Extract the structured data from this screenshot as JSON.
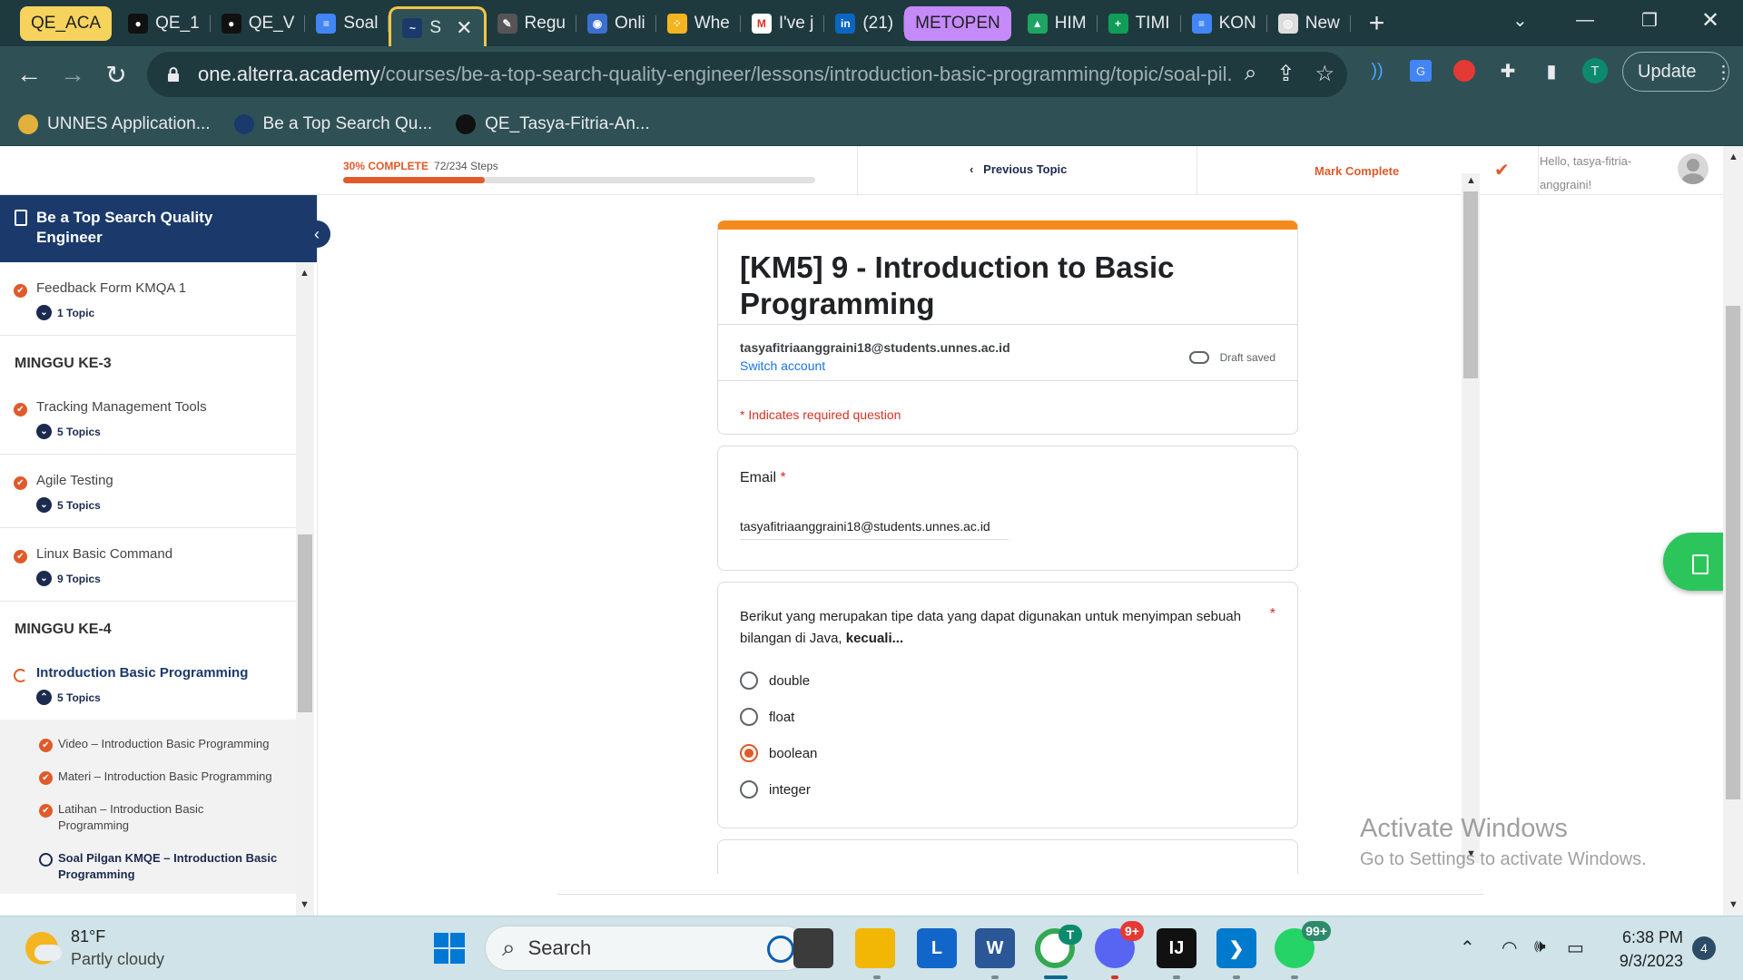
{
  "browser": {
    "tabs": [
      {
        "label": "QE_ACA",
        "kind": "group",
        "color": "#f6d35c",
        "text_color": "#202124"
      },
      {
        "label": "QE_1",
        "icon": "github-icon"
      },
      {
        "label": "QE_V",
        "icon": "github-icon"
      },
      {
        "label": "Soal",
        "icon": "docs-icon"
      },
      {
        "label": "S",
        "icon": "alterra-icon",
        "active": true
      },
      {
        "label": "Regu",
        "icon": "pen-icon"
      },
      {
        "label": "Onli",
        "icon": "circle-icon"
      },
      {
        "label": "Whe",
        "icon": "dots-icon"
      },
      {
        "label": "I've j",
        "icon": "gmail-icon"
      },
      {
        "label": "(21)",
        "icon": "linkedin-icon"
      },
      {
        "label": "METOPEN",
        "kind": "group",
        "color": "#c58af9",
        "text_color": "#202124"
      },
      {
        "label": "HIM",
        "icon": "drive-icon"
      },
      {
        "label": "TIMI",
        "icon": "sheets-icon"
      },
      {
        "label": "KON",
        "icon": "docs-icon"
      },
      {
        "label": "New",
        "icon": "chrome-icon"
      }
    ],
    "url_host": "one.alterra.academy",
    "url_path": "/courses/be-a-top-search-quality-engineer/lessons/introduction-basic-programming/topic/soal-pil...",
    "profile_initial": "T",
    "update_label": "Update",
    "bookmarks": [
      {
        "label": "UNNES Application...",
        "icon": "unnes-icon"
      },
      {
        "label": "Be a Top Search Qu...",
        "icon": "alterra-icon"
      },
      {
        "label": "QE_Tasya-Fitria-An...",
        "icon": "github-icon"
      }
    ]
  },
  "topbar": {
    "progress_pct_label": "30% COMPLETE",
    "progress_steps": "72/234 Steps",
    "progress_fraction": 0.3,
    "prev_topic": "Previous Topic",
    "mark_complete": "Mark Complete",
    "greeting": "Hello, tasya-fitria-anggraini!"
  },
  "sidebar": {
    "course_title": "Be a Top Search Quality Engineer",
    "lessons_before": [
      {
        "title": "Feedback Form KMQA 1",
        "topics": "1 Topic"
      }
    ],
    "section3": "MINGGU KE-3",
    "section3_lessons": [
      {
        "title": "Tracking Management Tools",
        "topics": "5 Topics"
      },
      {
        "title": "Agile Testing",
        "topics": "5 Topics"
      },
      {
        "title": "Linux Basic Command",
        "topics": "9 Topics"
      }
    ],
    "section4": "MINGGU KE-4",
    "current_lesson": {
      "title": "Introduction Basic Programming",
      "topics": "5 Topics"
    },
    "sub_topics": [
      {
        "title": "Video – Introduction Basic Programming",
        "done": true
      },
      {
        "title": "Materi – Introduction Basic Programming",
        "done": true
      },
      {
        "title": "Latihan – Introduction Basic Programming",
        "done": true
      },
      {
        "title": "Soal Pilgan KMQE – Introduction Basic Programming",
        "done": false,
        "active": true
      }
    ]
  },
  "form": {
    "title": "[KM5] 9 - Introduction to Basic Programming",
    "account_email": "tasyafitriaanggraini18@students.unnes.ac.id",
    "switch_account": "Switch account",
    "draft_status": "Draft saved",
    "required_note": "* Indicates required question",
    "email_label": "Email",
    "email_value": "tasyafitriaanggraini18@students.unnes.ac.id",
    "question1_text": "Berikut yang merupakan tipe data yang dapat digunakan untuk menyimpan sebuah bilangan di Java, ",
    "question1_emphasis": "kecuali...",
    "question1_options": [
      "double",
      "float",
      "boolean",
      "integer"
    ],
    "question1_selected": "boolean"
  },
  "watermark": {
    "line1": "Activate Windows",
    "line2": "Go to Settings to activate Windows."
  },
  "taskbar": {
    "weather_temp": "81°F",
    "weather_desc": "Partly cloudy",
    "search_placeholder": "Search",
    "time": "6:38 PM",
    "date": "9/3/2023",
    "notification_count": "4",
    "chrome_profile_badge": "T",
    "discord_badge": "9+",
    "whatsapp_badge": "99+"
  }
}
